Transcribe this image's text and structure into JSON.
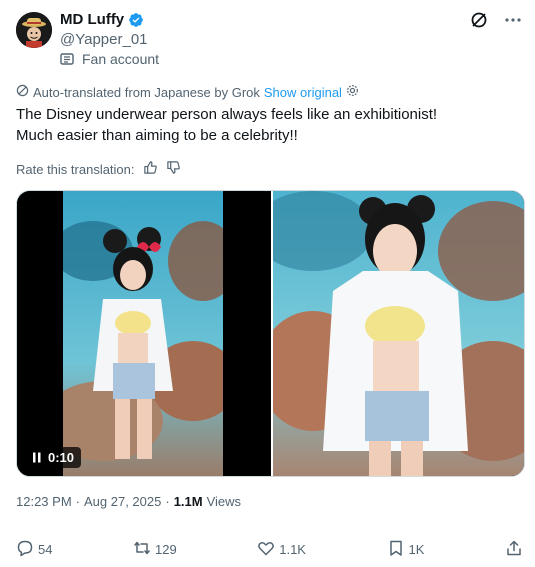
{
  "author": {
    "display_name": "MD Luffy",
    "handle": "@Yapper_01",
    "label": "Fan account",
    "avatar_icon": "straw-hat-avatar",
    "verified_icon": "verified-badge-icon",
    "verified_color": "#1d9bf0"
  },
  "top_actions": {
    "grok_icon": "grok-icon",
    "more_icon": "more-icon"
  },
  "translation": {
    "notice": "Auto-translated from Japanese by Grok",
    "show_original": "Show original",
    "rate_label": "Rate this translation:"
  },
  "tweet": {
    "lines": [
      "The Disney underwear person always feels like an exhibitionist!",
      "Much easier than aiming to be a celebrity!!"
    ]
  },
  "media": {
    "video_time": "0:10"
  },
  "meta": {
    "time": "12:23 PM",
    "separator": "·",
    "date": "Aug 27, 2025",
    "views_count": "1.1M",
    "views_label": "Views"
  },
  "actions": {
    "replies": "54",
    "reposts": "129",
    "likes": "1.1K",
    "bookmarks": "1K"
  },
  "colors": {
    "accent": "#1d9bf0",
    "muted_text": "#536471",
    "primary_text": "#0f1419",
    "border": "#cfd9de"
  }
}
